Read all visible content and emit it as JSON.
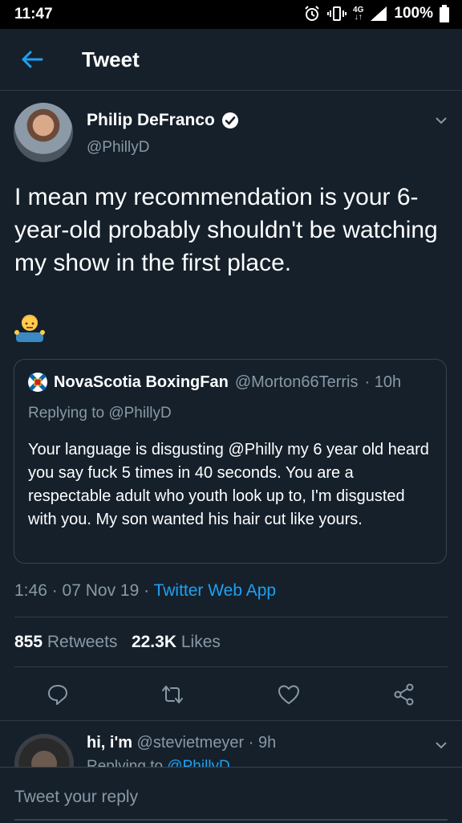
{
  "status_bar": {
    "time": "11:47",
    "network": "4G",
    "battery": "100%"
  },
  "header": {
    "title": "Tweet"
  },
  "tweet": {
    "author_name": "Philip DeFranco",
    "author_handle": "@PhillyD",
    "text": "I mean my recommendation is your 6-year-old probably shouldn't be watching my show in the first place.",
    "emoji": "person-shrugging-emoji",
    "timestamp": "1:46 · 07 Nov 19 · ",
    "source": "Twitter Web App",
    "retweets_count": "855",
    "retweets_label": "Retweets",
    "likes_count": "22.3K",
    "likes_label": "Likes"
  },
  "quoted_tweet": {
    "author_name": "NovaScotia BoxingFan",
    "author_handle": "@Morton66Terris",
    "time": "· 10h",
    "replying_to": "Replying to @PhillyD",
    "text": "Your language is disgusting @Philly my 6 year old heard you say fuck 5 times in 40 seconds. You are a respectable adult who youth look up to, I'm disgusted with you. My son wanted his hair cut like yours."
  },
  "reply_preview": {
    "author_name": "hi, i'm",
    "author_handle": "@stevietmeyer",
    "time": "· 9h",
    "replying_prefix": "Replying to ",
    "replying_handle": "@PhillyD"
  },
  "compose": {
    "placeholder": "Tweet your reply"
  },
  "colors": {
    "background": "#15202b",
    "accent": "#1da1f2",
    "secondary_text": "#8899a6",
    "border": "#38444d"
  }
}
